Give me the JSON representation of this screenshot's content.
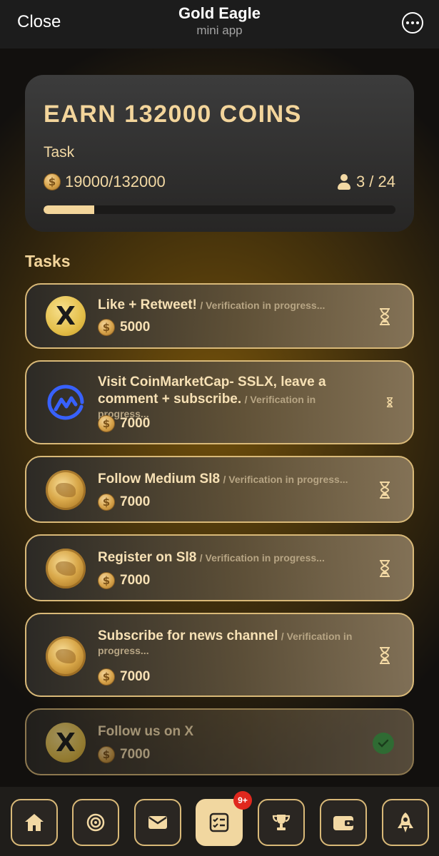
{
  "header": {
    "close_label": "Close",
    "app_title": "Gold Eagle",
    "app_subtitle": "mini app",
    "more_icon": "more-horizontal-icon"
  },
  "earn_card": {
    "title": "EARN 132000 COINS",
    "label": "Task",
    "coin_symbol": "$",
    "progress_text": "19000/132000",
    "progress_value": 19000,
    "progress_max": 132000,
    "players_text": "3 / 24"
  },
  "tasks_heading": "Tasks",
  "tasks": [
    {
      "icon": "x-logo-icon",
      "icon_char": "X",
      "title": "Like + Retweet!",
      "status": "/ Verification in progress...",
      "reward": "5000",
      "state": "pending"
    },
    {
      "icon": "coinmarketcap-logo-icon",
      "title": "Visit CoinMarketCap- SSLX, leave a comment + subscribe.",
      "status": "/ Verification in progress...",
      "reward": "7000",
      "state": "pending"
    },
    {
      "icon": "gold-eagle-coin-icon",
      "title": "Follow Medium Sl8",
      "status": "/ Verification in progress...",
      "reward": "7000",
      "state": "pending"
    },
    {
      "icon": "gold-eagle-coin-icon",
      "title": "Register on Sl8",
      "status": "/ Verification in progress...",
      "reward": "7000",
      "state": "pending"
    },
    {
      "icon": "gold-eagle-coin-icon",
      "title": "Subscribe for news channel",
      "status": "/ Verification in progress...",
      "reward": "7000",
      "state": "pending"
    },
    {
      "icon": "x-logo-icon",
      "icon_char": "X",
      "title": "Follow us on X",
      "status": "",
      "reward": "7000",
      "state": "done"
    }
  ],
  "bottom_nav": {
    "items": [
      {
        "icon": "home-icon",
        "active": false
      },
      {
        "icon": "target-icon",
        "active": false
      },
      {
        "icon": "mail-icon",
        "active": false
      },
      {
        "icon": "tasks-checklist-icon",
        "active": true
      },
      {
        "icon": "trophy-icon",
        "active": false
      },
      {
        "icon": "wallet-icon",
        "active": false
      },
      {
        "icon": "rocket-icon",
        "active": false
      }
    ],
    "badge": "9+"
  },
  "colors": {
    "accent": "#f3d59b",
    "border": "#d9b978",
    "badge": "#e0281e",
    "success": "#42a34a",
    "cmc_blue": "#3861fb"
  }
}
